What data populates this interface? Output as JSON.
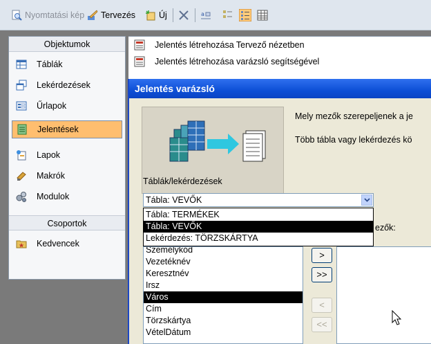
{
  "toolbar": {
    "preview_label": "Nyomtatási kép",
    "design_label": "Tervezés",
    "new_label": "Új"
  },
  "objects": {
    "header": "Objektumok",
    "items": [
      {
        "label": "Táblák"
      },
      {
        "label": "Lekérdezések"
      },
      {
        "label": "Űrlapok"
      },
      {
        "label": "Jelentések"
      },
      {
        "label": "Lapok"
      },
      {
        "label": "Makrók"
      },
      {
        "label": "Modulok"
      }
    ],
    "groups_header": "Csoportok",
    "favorites_label": "Kedvencek"
  },
  "main_list": [
    {
      "label": "Jelentés létrehozása Tervező nézetben"
    },
    {
      "label": "Jelentés létrehozása varázsló segítségével"
    }
  ],
  "dialog": {
    "title": "Jelentés varázsló",
    "question1": "Mely mezők szerepeljenek a je",
    "question2": "Több tábla vagy lekérdezés kö",
    "tables_label": "Táblák/lekérdezések",
    "combo_value": "Tábla: VEVŐK",
    "dropdown_options": [
      {
        "label": "Tábla: TERMÉKEK"
      },
      {
        "label": "Tábla: VEVŐK"
      },
      {
        "label": "Lekérdezés: TÖRZSKÁRTYA"
      }
    ],
    "selected_fields_label": "ezők:",
    "fields": [
      {
        "label": "Személykód"
      },
      {
        "label": "Vezetéknév"
      },
      {
        "label": "Keresztnév"
      },
      {
        "label": "Irsz"
      },
      {
        "label": "Város"
      },
      {
        "label": "Cím"
      },
      {
        "label": "Törzskártya"
      },
      {
        "label": "VételDátum"
      }
    ],
    "btn_add": ">",
    "btn_add_all": ">>",
    "btn_remove": "<",
    "btn_remove_all": "<<"
  },
  "colors": {
    "selected_object": "#ffbe6f",
    "titlebar": "#0d4fd6",
    "highlight": "#000000"
  }
}
